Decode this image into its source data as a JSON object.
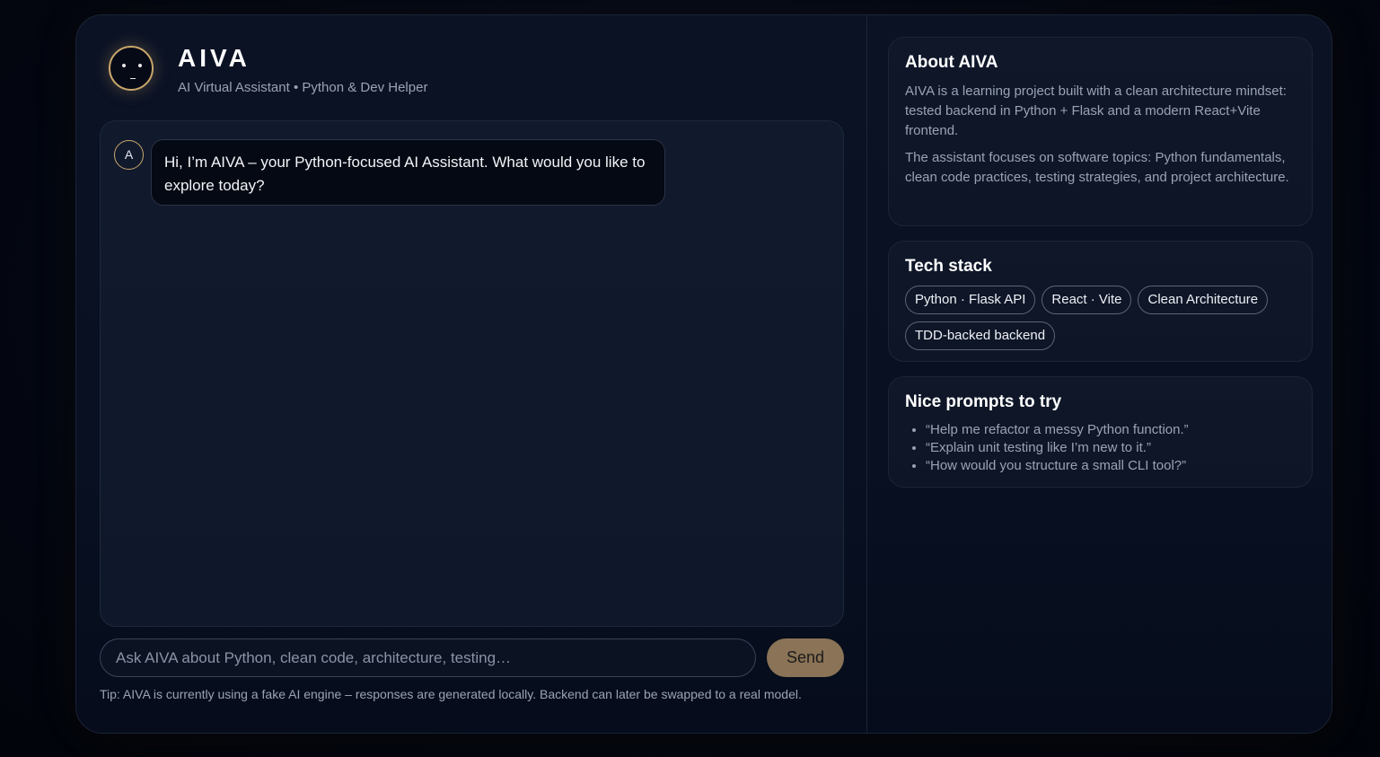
{
  "header": {
    "title": "AIVA",
    "subtitle": "AI Virtual Assistant • Python & Dev Helper"
  },
  "chat": {
    "messages": [
      {
        "sender_initial": "A",
        "text": "Hi, I’m AIVA – your Python-focused AI Assistant. What would you like to explore today?"
      }
    ]
  },
  "composer": {
    "placeholder": "Ask AIVA about Python, clean code, architecture, testing…",
    "value": "",
    "send_label": "Send",
    "tip": "Tip: AIVA is currently using a fake AI engine – responses are generated locally. Backend can later be swapped to a real model."
  },
  "about": {
    "title": "About AIVA",
    "paragraphs": [
      "AIVA is a learning project built with a clean architecture mindset: tested backend in Python + Flask and a modern React+Vite frontend.",
      "The assistant focuses on software topics: Python fundamentals, clean code practices, testing strategies, and project architecture."
    ]
  },
  "tech_stack": {
    "title": "Tech stack",
    "chips": [
      "Python · Flask API",
      "React · Vite",
      "Clean Architecture",
      "TDD-backed backend"
    ]
  },
  "prompts": {
    "title": "Nice prompts to try",
    "items": [
      "“Help me refactor a messy Python function.”",
      "“Explain unit testing like I’m new to it.”",
      "“How would you structure a small CLI tool?”"
    ]
  },
  "colors": {
    "accent": "#c9a66b",
    "send_button": "#8a7356",
    "background": "#040814"
  }
}
